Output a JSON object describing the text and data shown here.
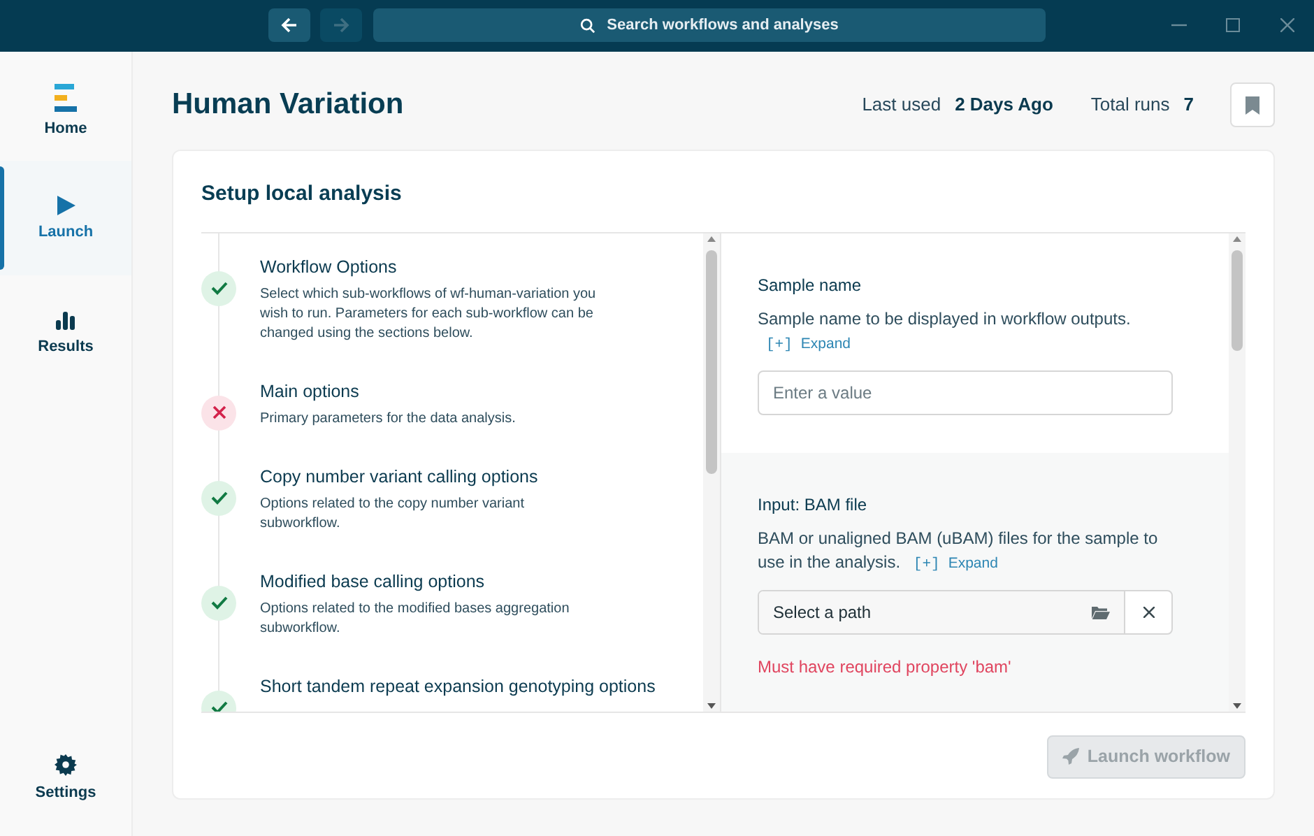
{
  "titlebar": {
    "search_placeholder": "Search workflows and analyses",
    "back_disabled": false,
    "forward_disabled": true
  },
  "sidebar": {
    "items": [
      {
        "label": "Home",
        "kind": "home",
        "selected": false
      },
      {
        "label": "Launch",
        "kind": "launch",
        "selected": true
      },
      {
        "label": "Results",
        "kind": "results",
        "selected": false
      }
    ],
    "footer": {
      "label": "Settings",
      "kind": "settings",
      "selected": false
    }
  },
  "header": {
    "title": "Human Variation",
    "last_used_label": "Last used",
    "last_used_value": "2 Days Ago",
    "total_runs_label": "Total runs",
    "total_runs_value": "7",
    "bookmarked": false
  },
  "card": {
    "title": "Setup local analysis",
    "sections": [
      {
        "title": "Workflow Options",
        "description": "Select which sub-workflows of wf-human-variation you wish to run. Parameters for each sub-workflow can be changed using the sections below.",
        "valid": true
      },
      {
        "title": "Main options",
        "description": "Primary parameters for the data analysis.",
        "valid": false
      },
      {
        "title": "Copy number variant calling options",
        "description": "Options related to the copy number variant subworkflow.",
        "valid": true
      },
      {
        "title": "Modified base calling options",
        "description": "Options related to the modified bases aggregation subworkflow.",
        "valid": true
      },
      {
        "title": "Short tandem repeat expansion genotyping options",
        "valid": true
      }
    ],
    "fields": [
      {
        "kind": "text",
        "label": "Sample name",
        "description": "Sample name to be displayed in workflow outputs.",
        "expand_mark": "[+]",
        "expand_label": "Expand",
        "placeholder": "Enter a value",
        "highlighted": false
      },
      {
        "kind": "path",
        "label": "Input: BAM file",
        "description": "BAM or unaligned BAM (uBAM) files for the sample to use in the analysis.",
        "expand_mark": "[+]",
        "expand_label": "Expand",
        "placeholder": "Select a path",
        "error": "Must have required property 'bam'",
        "highlighted": true
      }
    ],
    "launch_button": {
      "label": "Launch workflow",
      "disabled": true
    }
  }
}
